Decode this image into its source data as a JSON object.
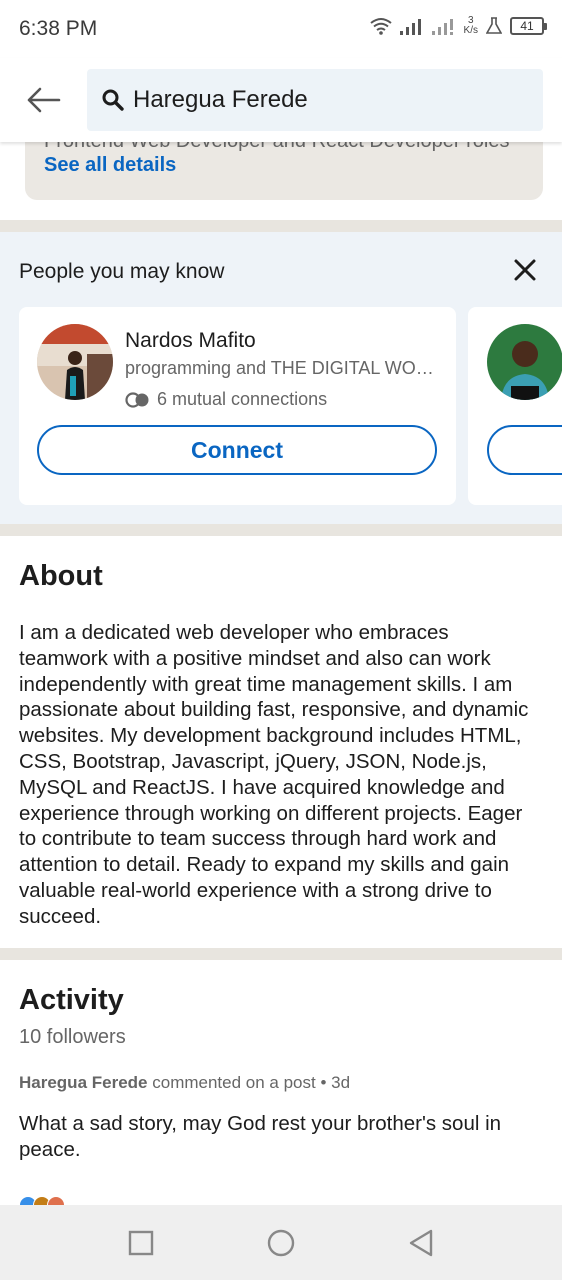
{
  "status_bar": {
    "time": "6:38 PM",
    "net_speed_value": "3",
    "net_speed_unit": "K/s",
    "battery": "41"
  },
  "search": {
    "query": "Haregua Ferede"
  },
  "previous_card": {
    "cutoff_text": "Frontend Web Developer and React Developer roles",
    "see_all_label": "See all details"
  },
  "pymk": {
    "title": "People you may know",
    "people": [
      {
        "name": "Nardos Mafito",
        "headline": "programming and THE DIGITAL WORLD",
        "mutual": "6 mutual connections",
        "connect_label": "Connect"
      },
      {
        "name": "",
        "headline": "",
        "mutual": "",
        "connect_label": ""
      }
    ]
  },
  "about": {
    "title": "About",
    "body": "I am a dedicated web developer who embraces teamwork with a positive mindset and also can work independently with great time management skills. I am passionate about building fast, responsive, and dynamic websites. My development background includes HTML, CSS, Bootstrap, Javascript, jQuery, JSON, Node.js, MySQL and ReactJS. I have acquired knowledge and experience through working on different projects. Eager to contribute to team success through hard work and attention to detail. Ready to expand my skills and gain valuable real-world experience with a strong drive to succeed."
  },
  "activity": {
    "title": "Activity",
    "followers": "10 followers",
    "post_author": "Haregua Ferede",
    "post_action": "commented on a post",
    "post_time": "3d",
    "post_text": "What a sad story, may God rest your brother's soul in peace."
  },
  "colors": {
    "accent": "#0a66c2",
    "divider": "#e8e5df",
    "pymk_bg": "#eef3f8"
  }
}
